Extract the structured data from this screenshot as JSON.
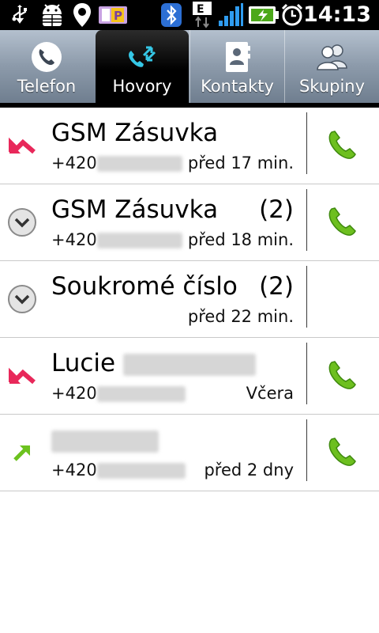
{
  "status_bar": {
    "time": "14:13",
    "network_type": "E",
    "icons": [
      "usb-icon",
      "android-debug-icon",
      "location-icon",
      "parking-app-icon",
      "bluetooth-icon",
      "edge-data-icon",
      "signal-icon",
      "battery-charging-icon",
      "alarm-icon"
    ]
  },
  "tabs": [
    {
      "label": "Telefon",
      "icon": "phone-icon",
      "active": false
    },
    {
      "label": "Hovory",
      "icon": "call-log-icon",
      "active": true
    },
    {
      "label": "Kontakty",
      "icon": "contact-card-icon",
      "active": false
    },
    {
      "label": "Skupiny",
      "icon": "group-icon",
      "active": false
    }
  ],
  "calls": [
    {
      "name": "GSM Zásuvka",
      "count": "",
      "number_prefix": "+420",
      "time": "před 17 min.",
      "type": "missed",
      "has_call_button": true
    },
    {
      "name": "GSM Zásuvka",
      "count": "(2)",
      "number_prefix": "+420",
      "time": "před 18 min.",
      "type": "expand",
      "has_call_button": true
    },
    {
      "name": "Soukromé číslo",
      "count": "(2)",
      "number_prefix": "",
      "time": "před 22 min.",
      "type": "expand",
      "has_call_button": false
    },
    {
      "name": "Lucie",
      "count": "",
      "number_prefix": "+420",
      "time": "Včera",
      "type": "missed",
      "has_call_button": true
    },
    {
      "name": "",
      "count": "",
      "number_prefix": "+420",
      "time": "před 2 dny",
      "type": "outgoing",
      "has_call_button": true
    }
  ],
  "colors": {
    "missed": "#e8285a",
    "outgoing": "#6cc21f",
    "call_button": "#6dbf1f",
    "active_tab_icon": "#35c7e6",
    "tab_bar": "#8d9bab"
  }
}
